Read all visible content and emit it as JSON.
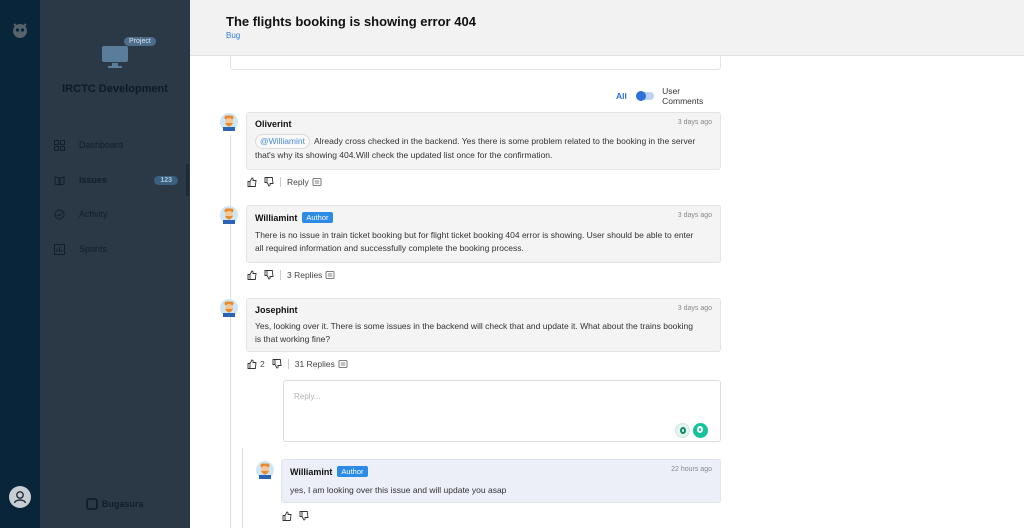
{
  "colors": {
    "accent": "#2d8be8",
    "toggle": "#2f6fd8",
    "rail": "#08253a",
    "sidebar_dim": "#2b3946"
  },
  "sidebar": {
    "project_badge": "Project",
    "project_title": "IRCTC Development",
    "items": [
      {
        "label": "Dashboard",
        "icon": "grid-icon"
      },
      {
        "label": "Issues",
        "icon": "book-icon",
        "count": "123"
      },
      {
        "label": "Activity",
        "icon": "check-circle-icon"
      },
      {
        "label": "Sprints",
        "icon": "chart-icon"
      }
    ],
    "brand": "Bugasura"
  },
  "issue": {
    "title": "The flights booking is showing error 404",
    "tag": "Bug"
  },
  "filter": {
    "all_label": "All",
    "user_comments_label": "User Comments"
  },
  "comments": [
    {
      "author": "Oliverint",
      "badge": "",
      "time": "3 days ago",
      "mention": "@Williamint",
      "body_line1": "Already cross checked in the backend. Yes there is some problem related to the booking in the server",
      "body_line2": "that's why its showing 404.Will check the updated list once for the confirmation.",
      "reply_label": "Reply"
    },
    {
      "author": "Williamint",
      "badge": "Author",
      "time": "3 days ago",
      "body_line1": "There is no issue in train ticket booking but for flight ticket booking 404 error is showing. User should be able to enter",
      "body_line2": "all required information and successfully complete the booking process.",
      "replies_label": "3 Replies"
    },
    {
      "author": "Josephint",
      "badge": "",
      "time": "3 days ago",
      "body_line1": "Yes, looking over it. There is some issues in the backend will check that and update it. What about the trains booking",
      "body_line2": "is that working fine?",
      "likes": "2",
      "replies_label": "31 Replies"
    }
  ],
  "reply_box": {
    "placeholder": "Reply..."
  },
  "sub_reply": {
    "author": "Williamint",
    "badge": "Author",
    "time": "22 hours ago",
    "body": "yes, I am looking over this issue and will update you asap"
  }
}
